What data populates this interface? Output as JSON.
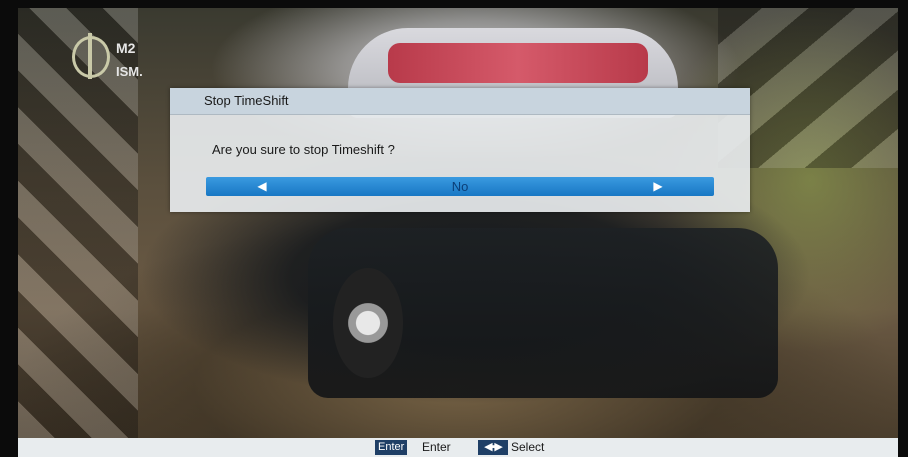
{
  "channel_logo": {
    "line1": "M2",
    "line2": "ISM."
  },
  "dialog": {
    "title": "Stop TimeShift",
    "message": "Are you  sure to stop  Timeshift ?",
    "selected_option": "No",
    "left_arrow": "◀",
    "right_arrow": "▶"
  },
  "help_bar": {
    "enter_key": "Enter",
    "enter_label": "Enter",
    "select_key": "◀▪▶",
    "select_label": "Select"
  },
  "colors": {
    "dialog_bg": "#e8ecee",
    "selection_bar": "#1877c4",
    "key_badge": "#1f3f66"
  }
}
